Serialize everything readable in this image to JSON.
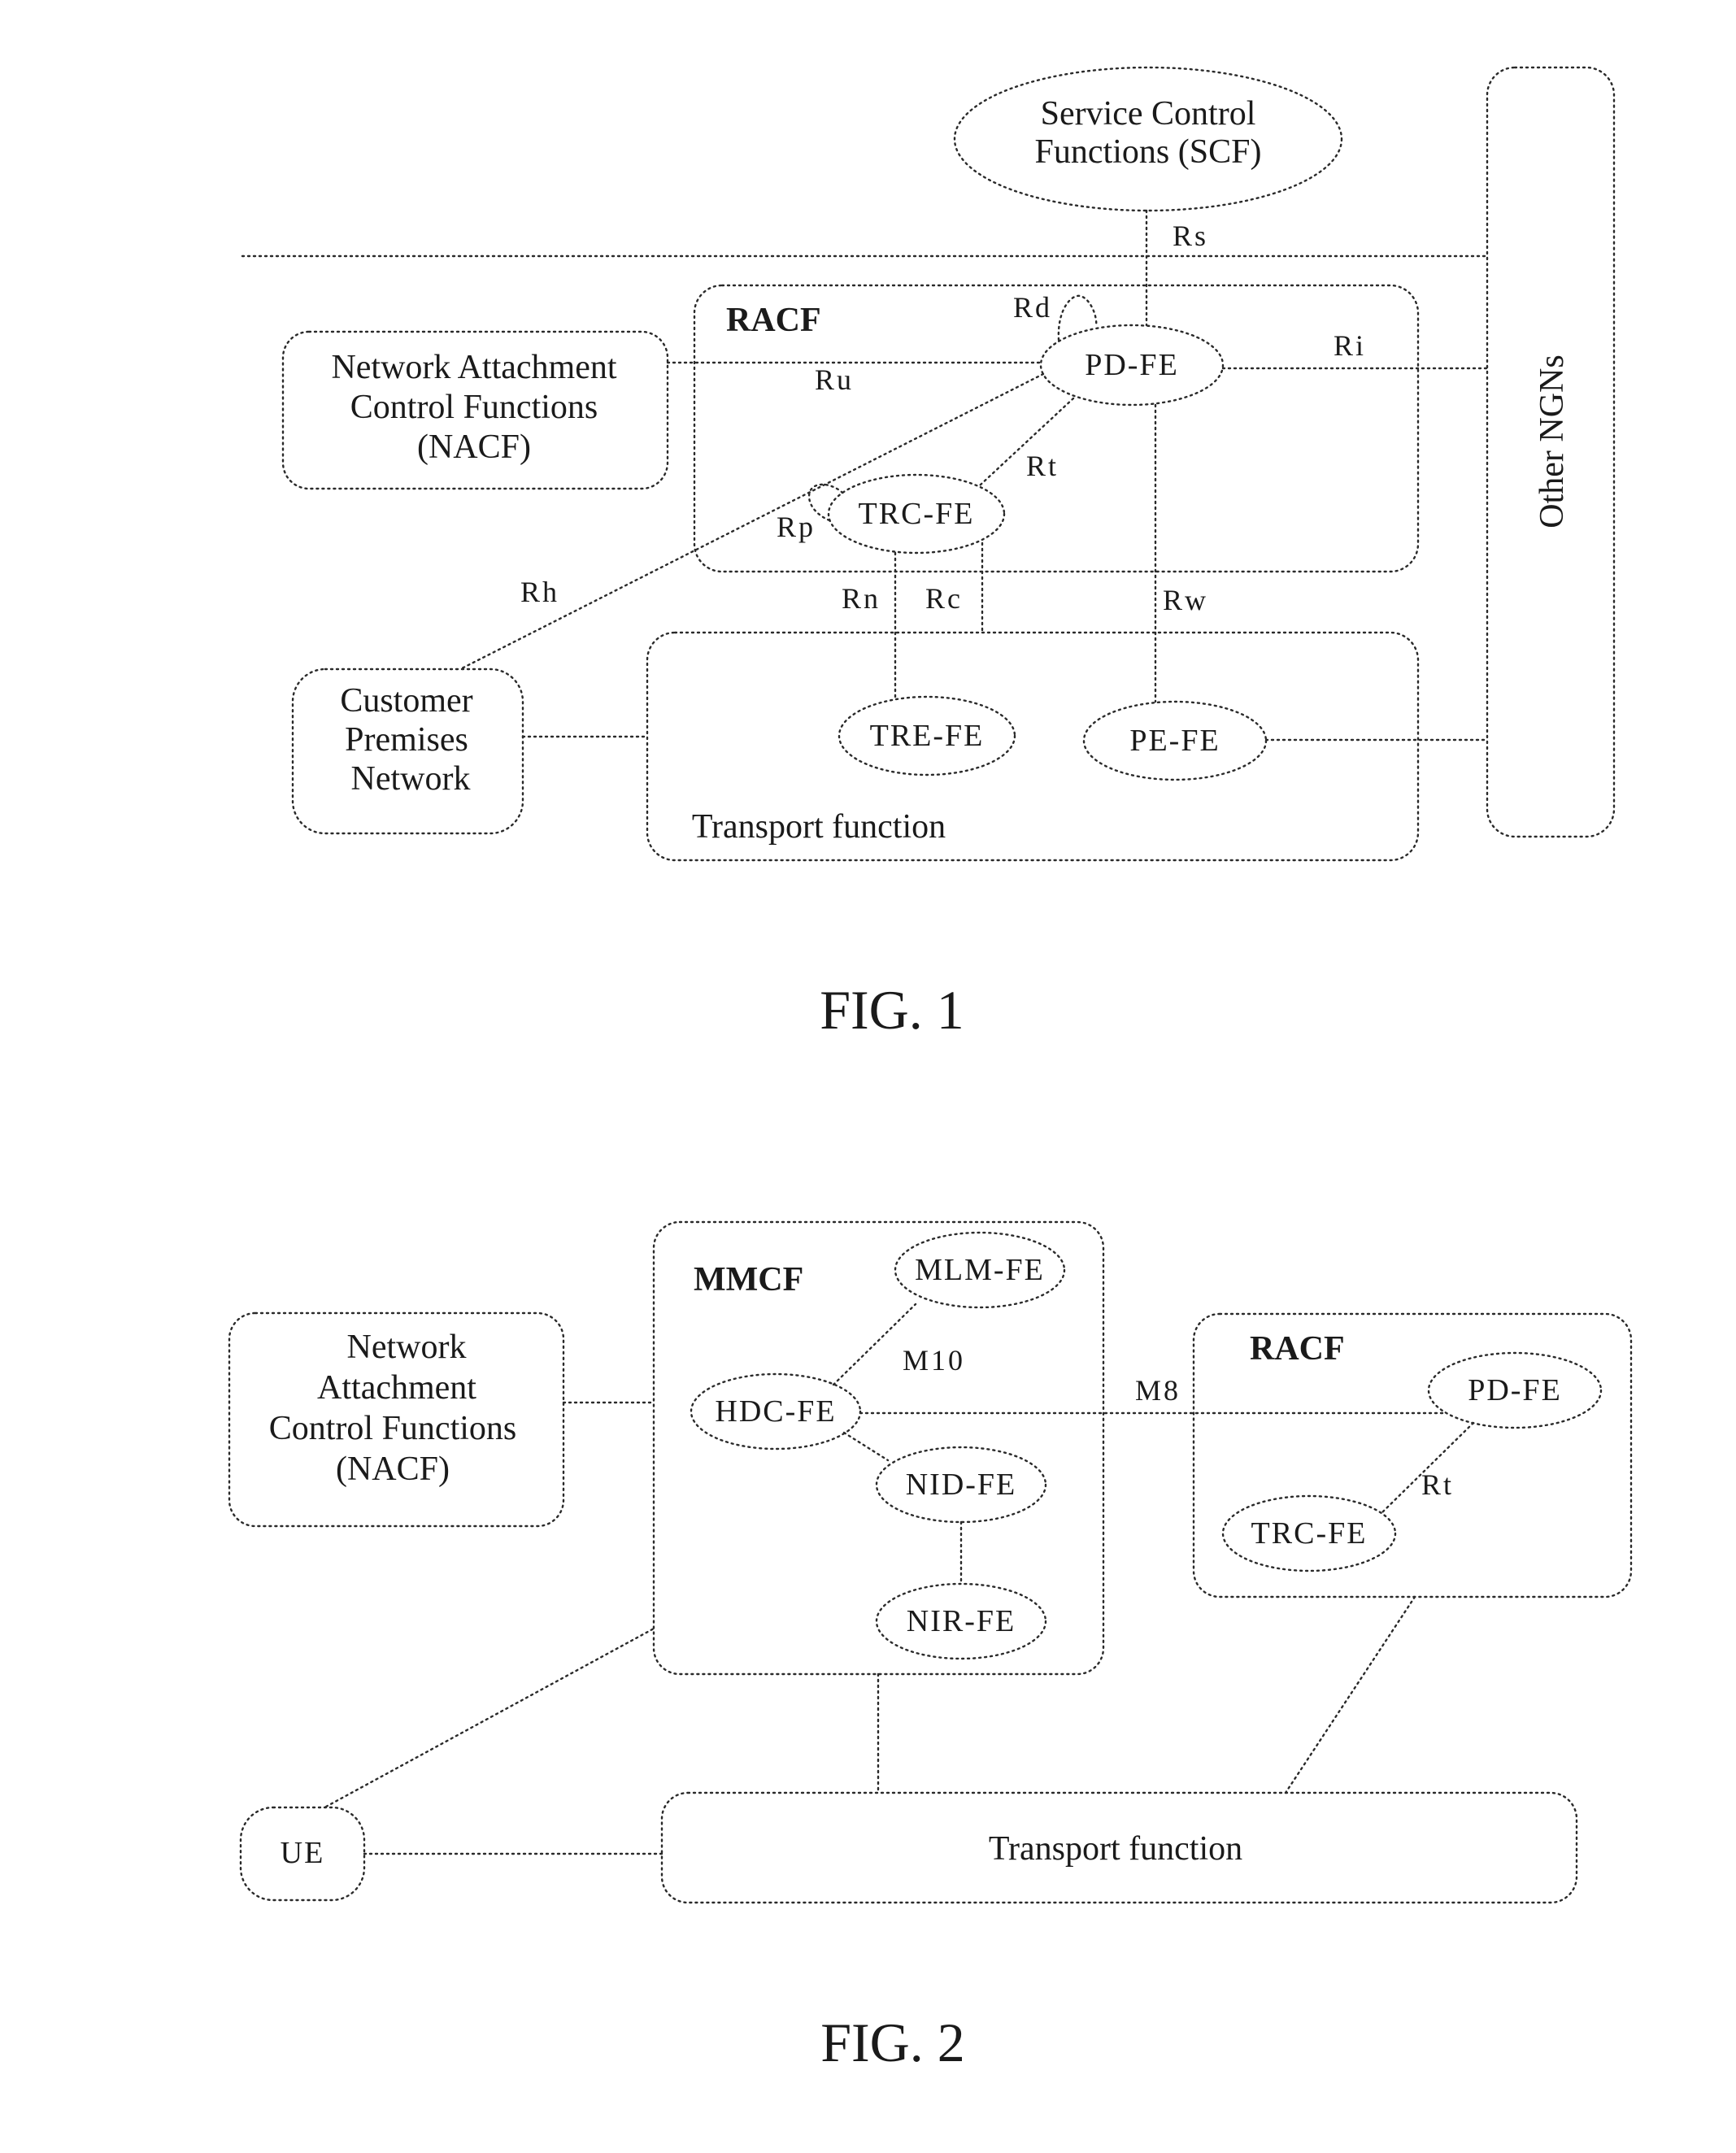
{
  "fig1": {
    "caption": "FIG. 1",
    "scf": {
      "lines": [
        "Service Control",
        "Functions (SCF)"
      ]
    },
    "other_ngns": "Other NGNs",
    "racf": {
      "title": "RACF"
    },
    "nacf": {
      "lines": [
        "Network Attachment",
        "Control Functions",
        "(NACF)"
      ]
    },
    "cpn": {
      "lines": [
        "Customer",
        "Premises",
        "Network"
      ]
    },
    "transport": {
      "label": "Transport function"
    },
    "entities": {
      "pd_fe": "PD-FE",
      "trc_fe": "TRC-FE",
      "tre_fe": "TRE-FE",
      "pe_fe": "PE-FE"
    },
    "interfaces": {
      "rs": "Rs",
      "rd": "Rd",
      "ri": "Ri",
      "ru": "Ru",
      "rt": "Rt",
      "rp": "Rp",
      "rh": "Rh",
      "rn": "Rn",
      "rc": "Rc",
      "rw": "Rw"
    }
  },
  "fig2": {
    "caption": "FIG. 2",
    "nacf": {
      "lines": [
        "Network",
        "Attachment",
        "Control Functions",
        "(NACF)"
      ]
    },
    "mmcf": {
      "title": "MMCF"
    },
    "racf": {
      "title": "RACF"
    },
    "ue": "UE",
    "transport": {
      "label": "Transport function"
    },
    "entities": {
      "mlm_fe": "MLM-FE",
      "hdc_fe": "HDC-FE",
      "nid_fe": "NID-FE",
      "nir_fe": "NIR-FE",
      "pd_fe": "PD-FE",
      "trc_fe": "TRC-FE"
    },
    "interfaces": {
      "m10": "M10",
      "m8": "M8",
      "rt": "Rt"
    }
  }
}
